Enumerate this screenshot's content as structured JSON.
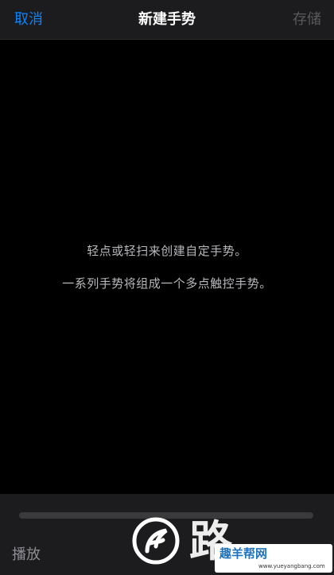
{
  "nav": {
    "cancel_label": "取消",
    "title": "新建手势",
    "save_label": "存储"
  },
  "canvas": {
    "hint_line_1": "轻点或轻扫来创建自定手势。",
    "hint_line_2": "一系列手势将组成一个多点触控手势。"
  },
  "bottom": {
    "play_label": "播放"
  },
  "watermark": {
    "site_name": "趣羊帮网",
    "url": "www.yueyangbang.com"
  },
  "colors": {
    "accent": "#0a84ff",
    "disabled": "#5a5a5e",
    "panel": "#1c1c1e",
    "background": "#000000"
  }
}
